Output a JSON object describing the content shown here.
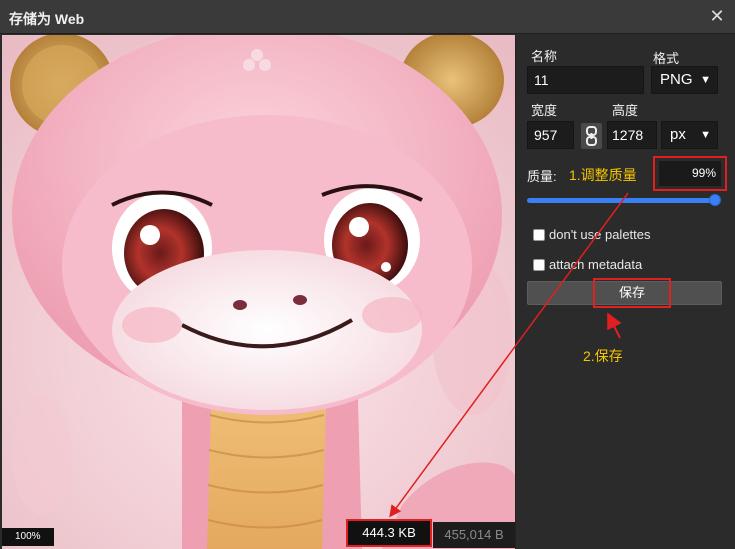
{
  "window": {
    "title": "存储为 Web",
    "close_glyph": "✕"
  },
  "form": {
    "name_label": "名称",
    "name_value": "11",
    "format_label": "格式",
    "format_value": "PNG",
    "width_label": "宽度",
    "width_value": "957",
    "height_label": "高度",
    "height_value": "1278",
    "unit_value": "px",
    "quality_label": "质量:",
    "quality_value": "99%",
    "quality_level": 0.99,
    "palettes_label": "don't use palettes",
    "palettes_checked": false,
    "metadata_label": "attach metadata",
    "metadata_checked": false,
    "save_label": "保存"
  },
  "annotations": {
    "step1": "1.调整质量",
    "step2": "2.保存",
    "highlight_color": "#e02020",
    "text_color": "#f5c400"
  },
  "status": {
    "zoom": "100%",
    "file_size": "444.3 KB",
    "byte_count": "455,014 B"
  },
  "icons": {
    "close": "close-icon",
    "link": "link-chain-icon",
    "chevron": "chevron-down-icon"
  },
  "colors": {
    "accent": "#3a7ff3",
    "panel": "#2b2b2b",
    "field": "#1c1c1c"
  }
}
